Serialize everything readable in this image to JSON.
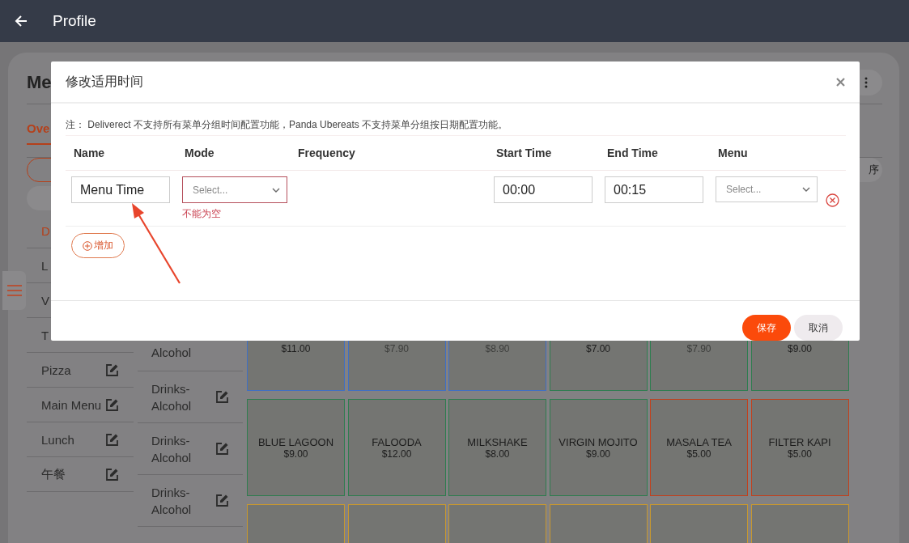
{
  "app_bar": {
    "title": "Profile"
  },
  "page": {
    "title": "Me",
    "tab": "Ove",
    "side_pill": "序",
    "categories_covered": [
      {
        "name": "D",
        "selected": true
      },
      {
        "name": "L",
        "selected": false
      },
      {
        "name": "V",
        "selected": false
      },
      {
        "name": "T",
        "selected": false
      }
    ],
    "categories": [
      {
        "name": "Pizza",
        "selected": false
      },
      {
        "name": "Main Menu",
        "selected": false
      },
      {
        "name": "Lunch",
        "selected": false
      },
      {
        "name": "午餐",
        "selected": false
      }
    ],
    "groups_covered": [
      {
        "name": "Alcohol"
      }
    ],
    "groups": [
      {
        "name": "Drinks-Alcohol"
      },
      {
        "name": "Drinks-Alcohol"
      },
      {
        "name": "Drinks-Alcohol"
      }
    ],
    "items": [
      {
        "price": "$11.00",
        "available": true,
        "color": "#3f6fc4"
      },
      {
        "price": "$7.90",
        "available": false,
        "color": "#3f6fc4"
      },
      {
        "price": "$8.90",
        "available": false,
        "color": "#3f6fc4"
      },
      {
        "price": "$7.00",
        "available": true,
        "color": "#2e7d4f"
      },
      {
        "price": "$7.90",
        "available": false,
        "color": "#2e7d4f"
      },
      {
        "price": "$9.00",
        "available": true,
        "color": "#2e7d4f"
      },
      {
        "name": "BLUE LAGOON",
        "price": "$9.00",
        "available": true,
        "color": "#2e7d4f"
      },
      {
        "name": "FALOODA",
        "price": "$12.00",
        "available": true,
        "color": "#2e7d4f"
      },
      {
        "name": "MILKSHAKE",
        "price": "$8.00",
        "available": true,
        "color": "#2e7d4f"
      },
      {
        "name": "VIRGIN MOJITO",
        "price": "$9.00",
        "available": true,
        "color": "#2e7d4f"
      },
      {
        "name": "MASALA TEA",
        "price": "$5.00",
        "available": true,
        "color": "#c2401c"
      },
      {
        "name": "FILTER KAPI",
        "price": "$5.00",
        "available": true,
        "color": "#c2401c"
      },
      {
        "color": "#c8982e"
      },
      {
        "color": "#c8982e"
      },
      {
        "color": "#c8982e"
      },
      {
        "color": "#c8982e"
      },
      {
        "color": "#c8982e"
      },
      {
        "color": "#c8982e"
      }
    ]
  },
  "dialog": {
    "title": "修改适用时间",
    "note": "注： Deliverect 不支持所有菜单分组时间配置功能，Panda Ubereats 不支持菜单分组按日期配置功能。",
    "columns": [
      "Name",
      "Mode",
      "Frequency",
      "Start Time",
      "End Time",
      "Menu"
    ],
    "rows": [
      {
        "name": "Menu Time",
        "mode": {
          "placeholder": "Select...",
          "error": "不能为空"
        },
        "start": "00:00",
        "end": "00:15",
        "menu": {
          "placeholder": "Select..."
        }
      }
    ],
    "add_button": "增加",
    "buttons": [
      {
        "label": "保存",
        "kind": "primary"
      },
      {
        "label": "取消",
        "kind": "secondary"
      }
    ]
  }
}
